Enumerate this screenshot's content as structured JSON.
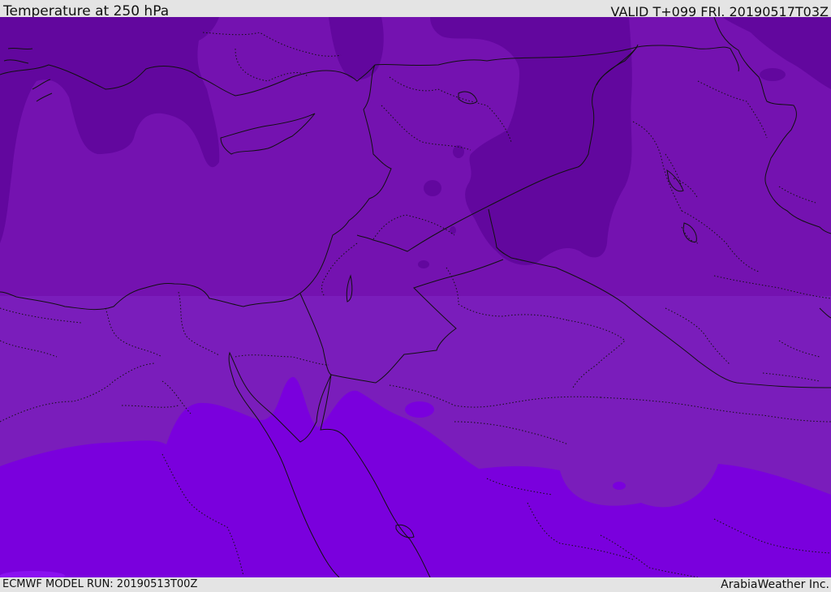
{
  "header": {
    "title": "Temperature at 250 hPa",
    "valid": "VALID T+099 FRI. 20190517T03Z"
  },
  "footer": {
    "model_run": "ECMWF MODEL RUN: 20190513T00Z",
    "credit": "ArabiaWeather Inc."
  },
  "colors": {
    "band_coldest": "#62079e",
    "band_cold": "#7412b0",
    "band_mid": "#7a1dbb",
    "band_warm": "#7a00dd",
    "borders": "#111111"
  }
}
